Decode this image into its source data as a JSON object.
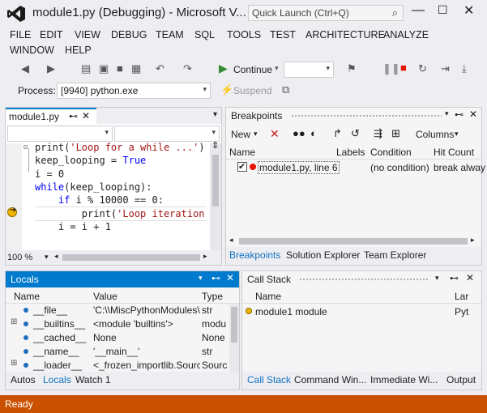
{
  "title": "module1.py (Debugging) - Microsoft V...",
  "quick_launch": "Quick Launch (Ctrl+Q)",
  "menu": [
    "FILE",
    "EDIT",
    "VIEW",
    "DEBUG",
    "TEAM",
    "SQL",
    "TOOLS",
    "TEST",
    "ARCHITECTURE",
    "ANALYZE",
    "WINDOW",
    "HELP"
  ],
  "toolbar": {
    "continue_label": "Continue",
    "process_label": "Process:",
    "process_value": "[9940] python.exe",
    "suspend_label": "Suspend"
  },
  "editor": {
    "tab_label": "module1.py",
    "zoom": "100 %",
    "lines": [
      {
        "segs": [
          {
            "t": "print(",
            "c": ""
          },
          {
            "t": "'Loop for a while ...'",
            "c": "str"
          },
          {
            "t": ")",
            "c": ""
          }
        ]
      },
      {
        "segs": [
          {
            "t": "keep_looping = ",
            "c": ""
          },
          {
            "t": "True",
            "c": "kw"
          }
        ]
      },
      {
        "segs": [
          {
            "t": "i = 0",
            "c": ""
          }
        ]
      },
      {
        "segs": [
          {
            "t": "while",
            "c": "kw"
          },
          {
            "t": "(keep_looping):",
            "c": ""
          }
        ]
      },
      {
        "segs": [
          {
            "t": "    ",
            "c": ""
          },
          {
            "t": "if",
            "c": "kw"
          },
          {
            "t": " i % 10000 == 0:",
            "c": ""
          }
        ]
      },
      {
        "segs": [
          {
            "t": "        print(",
            "c": ""
          },
          {
            "t": "'Loop iteration'",
            "c": "str"
          }
        ]
      },
      {
        "segs": [
          {
            "t": "    i = i + 1",
            "c": ""
          }
        ]
      }
    ]
  },
  "breakpoints": {
    "title": "Breakpoints",
    "new_label": "New",
    "columns_label": "Columns",
    "headers": [
      "Name",
      "Labels",
      "Condition",
      "Hit Count"
    ],
    "rows": [
      {
        "name": "module1.py, line 6",
        "labels": "",
        "condition": "(no condition)",
        "hit_count": "break alway"
      }
    ],
    "tabs": [
      "Breakpoints",
      "Solution Explorer",
      "Team Explorer"
    ]
  },
  "locals": {
    "title": "Locals",
    "headers": [
      "Name",
      "Value",
      "Type"
    ],
    "rows": [
      {
        "name": "__file__",
        "value": "'C:\\\\MiscPythonModules\\\\",
        "type": "str",
        "expand": false
      },
      {
        "name": "__builtins__",
        "value": "<module 'builtins'>",
        "type": "modu",
        "expand": true
      },
      {
        "name": "__cached__",
        "value": "None",
        "type": "None",
        "expand": false
      },
      {
        "name": "__name__",
        "value": "'__main__'",
        "type": "str",
        "expand": false
      },
      {
        "name": "__loader__",
        "value": "<_frozen_importlib.Source",
        "type": "Sourc",
        "expand": true
      }
    ],
    "tabs": [
      "Autos",
      "Locals",
      "Watch 1"
    ]
  },
  "callstack": {
    "title": "Call Stack",
    "headers": [
      "Name",
      "Lar"
    ],
    "rows": [
      {
        "name": "module1 module",
        "lang": "Pyt"
      }
    ],
    "tabs": [
      "Call Stack",
      "Command Win...",
      "Immediate Wi...",
      "Output"
    ]
  },
  "status": "Ready",
  "colors": {
    "accent": "#007acc",
    "status_bar": "#ca5100",
    "breakpoint": "#e51400",
    "arrow": "#f0b400"
  }
}
